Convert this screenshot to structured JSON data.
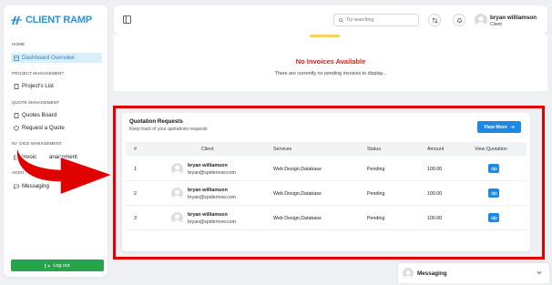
{
  "brand": {
    "name": "CLIENT RAMP",
    "color": "#2a93d5"
  },
  "sidebar": {
    "sections": [
      "HOME",
      "PROJECT MANAGEMENT",
      "QUOTE MANAGEMENT",
      "INVOICE MANAGEMENT",
      "ADDITIONAL FEA"
    ],
    "items": [
      {
        "label": "Dashboard Overview",
        "icon": "dashboard-icon",
        "active": true
      },
      {
        "label": "Project's List",
        "icon": "document-icon"
      },
      {
        "label": "Quotes Board",
        "icon": "document-icon"
      },
      {
        "label": "Request a Quote",
        "icon": "shield-icon"
      },
      {
        "label": "Invoice Management",
        "icon": "invoice-icon",
        "display": "Invoic        anagement"
      },
      {
        "label": "Messaging",
        "icon": "chat-icon"
      }
    ],
    "logout_label": "Log out"
  },
  "topbar": {
    "search_placeholder": "Try searching",
    "user_name": "bryan williamson",
    "user_role": "Client"
  },
  "invoices": {
    "empty_title": "No Invoices Available",
    "empty_subtitle": "There are currently no pending invoices to display..."
  },
  "quotations": {
    "title": "Quotation Requests",
    "subtitle": "Keep track of your quotations requests",
    "view_more_label": "View More",
    "columns": [
      "#",
      "Client",
      "Services",
      "Status",
      "Amount",
      "View Quotation"
    ],
    "rows": [
      {
        "num": "1",
        "name": "bryan williamson",
        "email": "bryan@spidernow.com",
        "services": "Web Design,Database",
        "status": "Pending",
        "amount": "100.00"
      },
      {
        "num": "2",
        "name": "bryan williamson",
        "email": "bryan@spidernow.com",
        "services": "Web Design,Database",
        "status": "Pending",
        "amount": "100.00"
      },
      {
        "num": "3",
        "name": "bryan williamson",
        "email": "bryan@spidernow.com",
        "services": "Web Design,Database",
        "status": "Pending",
        "amount": "100.00"
      }
    ]
  },
  "messaging_bar": {
    "label": "Messaging"
  },
  "colors": {
    "accent": "#1e88e5",
    "highlight": "#e00000",
    "logout": "#26a44a",
    "error": "#e02020"
  }
}
